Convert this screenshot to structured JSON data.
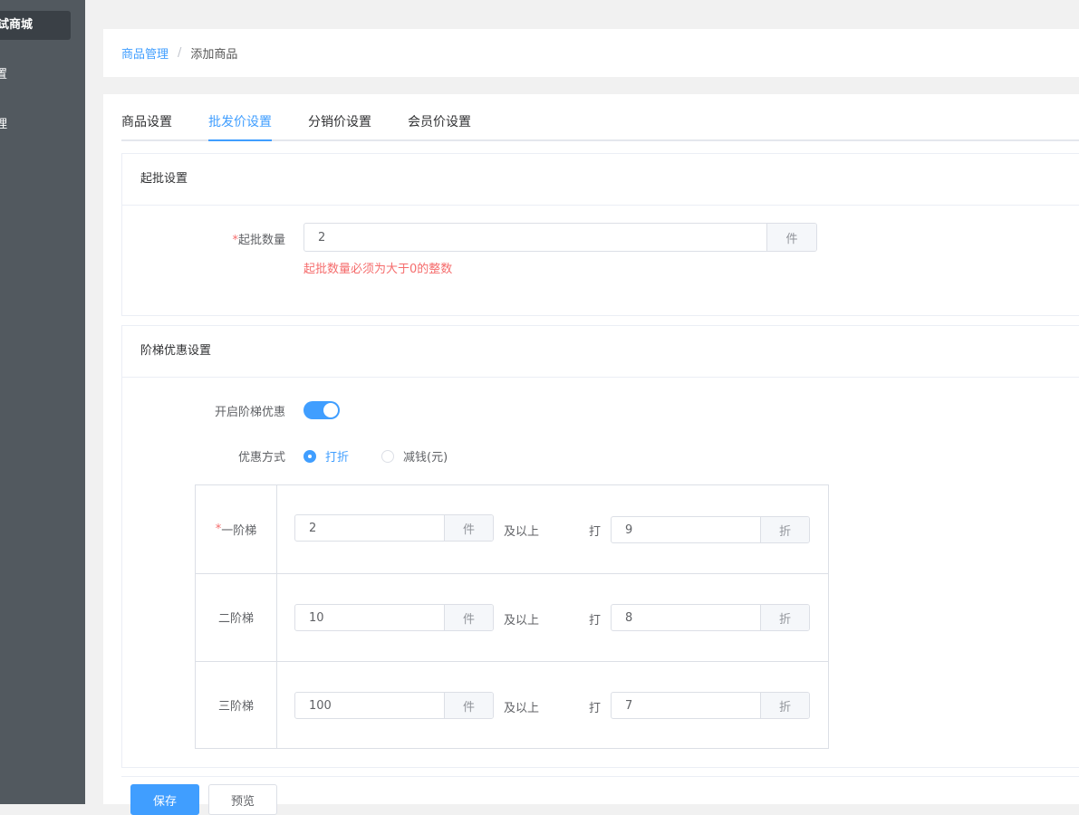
{
  "sidebar": {
    "shop_name": "试商城",
    "items": [
      {
        "label": "置"
      },
      {
        "label": "理"
      }
    ]
  },
  "breadcrumb": {
    "parent": "商品管理",
    "separator": "/",
    "current": "添加商品"
  },
  "tabs": [
    {
      "label": "商品设置",
      "active": false
    },
    {
      "label": "批发价设置",
      "active": true
    },
    {
      "label": "分销价设置",
      "active": false
    },
    {
      "label": "会员价设置",
      "active": false
    }
  ],
  "min_batch": {
    "title": "起批设置",
    "required_mark": "*",
    "label": "起批数量",
    "value": "2",
    "unit": "件",
    "error": "起批数量必须为大于0的整数"
  },
  "tiered": {
    "title": "阶梯优惠设置",
    "switch_label": "开启阶梯优惠",
    "switch_on": true,
    "method_label": "优惠方式",
    "method_options": [
      {
        "label": "打折",
        "selected": true
      },
      {
        "label": "减钱(元)",
        "selected": false
      }
    ],
    "tiers": [
      {
        "required_mark": "*",
        "label": "一阶梯",
        "qty": "2",
        "qty_unit": "件",
        "above": "及以上",
        "discount_prefix": "打",
        "discount": "9",
        "discount_unit": "折"
      },
      {
        "required_mark": "",
        "label": "二阶梯",
        "qty": "10",
        "qty_unit": "件",
        "above": "及以上",
        "discount_prefix": "打",
        "discount": "8",
        "discount_unit": "折"
      },
      {
        "required_mark": "",
        "label": "三阶梯",
        "qty": "100",
        "qty_unit": "件",
        "above": "及以上",
        "discount_prefix": "打",
        "discount": "7",
        "discount_unit": "折"
      }
    ]
  },
  "actions": {
    "save": "保存",
    "preview": "预览"
  },
  "colors": {
    "primary": "#409eff",
    "danger": "#f56c6c",
    "sidebar": "#52595f"
  }
}
